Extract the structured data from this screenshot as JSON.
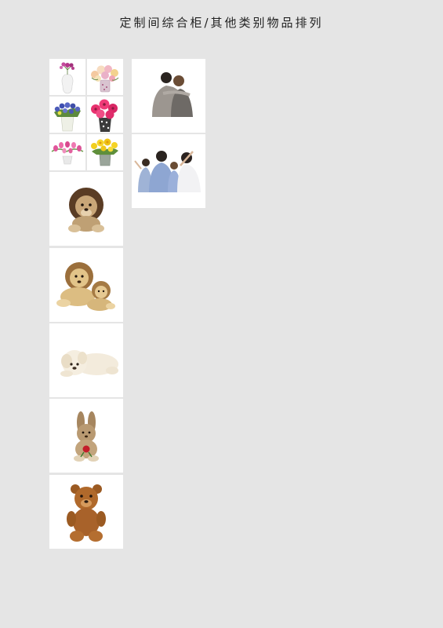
{
  "page": {
    "title": "定制间综合柜/其他类别物品排列"
  },
  "items": {
    "flowers": [
      {
        "icon": "vase-pink-orchid-icon"
      },
      {
        "icon": "vase-mixed-flowers-icon"
      },
      {
        "icon": "vase-blue-flowers-icon"
      },
      {
        "icon": "vase-pink-gerbera-icon"
      },
      {
        "icon": "vase-pink-tulips-icon"
      },
      {
        "icon": "vase-yellow-daffodils-icon"
      }
    ],
    "plush": [
      {
        "icon": "plush-lion-icon"
      },
      {
        "icon": "plush-lion-pair-icon"
      },
      {
        "icon": "plush-white-dog-icon"
      },
      {
        "icon": "plush-bunny-icon"
      },
      {
        "icon": "plush-teddy-bear-icon"
      }
    ],
    "people": [
      {
        "icon": "couple-from-behind-icon"
      },
      {
        "icon": "family-from-behind-icon"
      }
    ]
  },
  "colors": {
    "background": "#e5e5e5",
    "tile": "#ffffff",
    "title_text": "#222222"
  }
}
